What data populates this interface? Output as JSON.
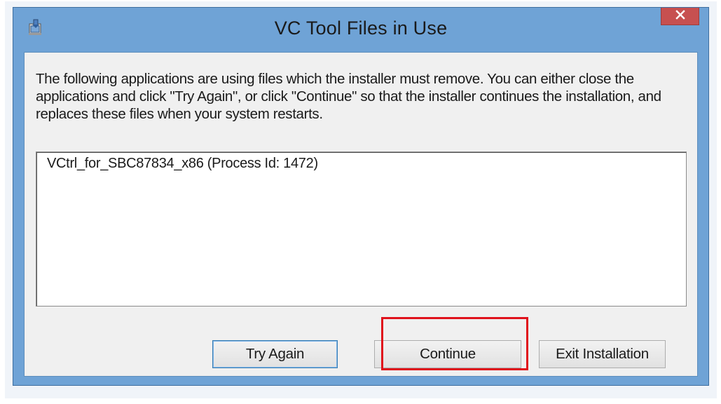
{
  "window": {
    "title": "VC Tool Files in Use",
    "app_icon": "installer-icon",
    "close_icon": "close-icon"
  },
  "message": "The following applications are using files which the installer must remove. You can either close the applications and click \"Try Again\", or click \"Continue\" so that the installer continues the installation, and replaces these files when your system restarts.",
  "process_list": {
    "items": [
      "VCtrl_for_SBC87834_x86 (Process Id: 1472)"
    ]
  },
  "buttons": {
    "try_again": "Try Again",
    "continue": "Continue",
    "exit": "Exit Installation"
  },
  "colors": {
    "titlebar": "#6fa3d6",
    "close_button": "#c75050",
    "highlight": "#e0121c",
    "client_bg": "#f0f0f0"
  }
}
